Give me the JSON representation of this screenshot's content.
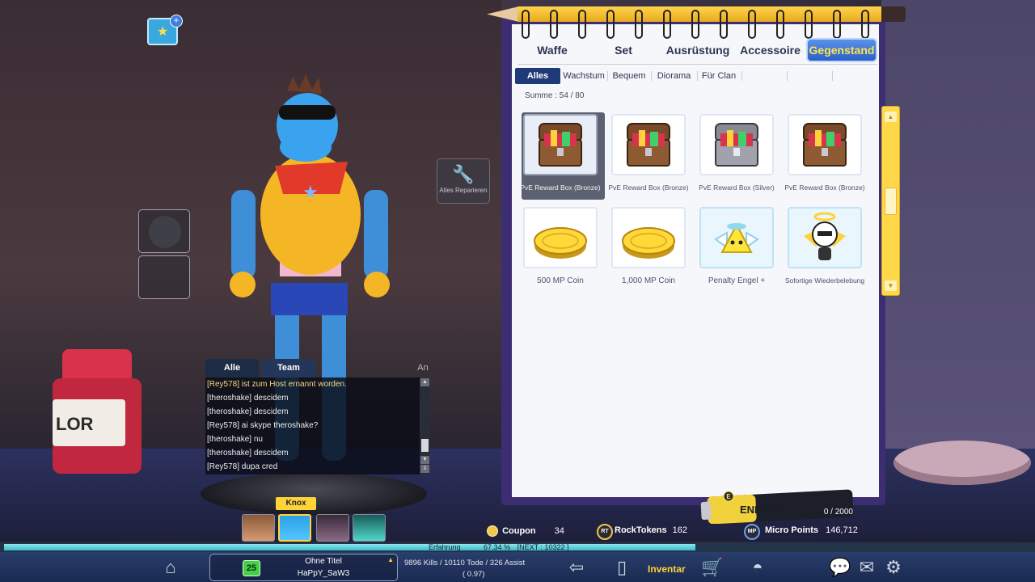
{
  "repair_label": "Alles Reparieren",
  "chat": {
    "tabs": [
      "Alle",
      "Team"
    ],
    "extra_tab": "An",
    "lines": [
      {
        "text": "[Rey578] ist zum Host ernannt worden.",
        "system": true
      },
      {
        "text": "[theroshake] descidem",
        "system": false
      },
      {
        "text": "[theroshake] descidem",
        "system": false
      },
      {
        "text": "[Rey578] ai skype theroshake?",
        "system": false
      },
      {
        "text": "[theroshake] nu",
        "system": false
      },
      {
        "text": "[theroshake] descidem",
        "system": false
      },
      {
        "text": "[Rey578] dupa cred",
        "system": false
      }
    ]
  },
  "character": {
    "nametag": "Knox",
    "portraits": [
      "character-portrait-1",
      "character-portrait-knox",
      "character-portrait-3",
      "character-portrait-4"
    ]
  },
  "inventory": {
    "main_tabs": [
      "Waffe",
      "Set",
      "Ausrüstung",
      "Accessoire",
      "Gegenstand"
    ],
    "active_main_tab": "Gegenstand",
    "sub_tabs": [
      "Alles",
      "Wachstum",
      "Bequem",
      "Diorama",
      "Für Clan"
    ],
    "active_sub_tab": "Alles",
    "summe_label": "Summe :",
    "summe_value": "54 / 80",
    "items": [
      {
        "name": "PvE Reward Box (Bronze)",
        "icon": "treasure-chest-icon",
        "selected": true
      },
      {
        "name": "PvE Reward Box (Bronze)",
        "icon": "treasure-chest-icon",
        "selected": false
      },
      {
        "name": "PvE Reward Box (Silver)",
        "icon": "treasure-chest-silver-icon",
        "selected": false
      },
      {
        "name": "PvE Reward Box (Bronze)",
        "icon": "treasure-chest-icon",
        "selected": false
      },
      {
        "name": "500 MP Coin",
        "icon": "mp-coin-icon",
        "selected": false
      },
      {
        "name": "1,000 MP Coin",
        "icon": "mp-coin-icon",
        "selected": false
      },
      {
        "name": "Penalty Engel +",
        "icon": "penalty-angel-icon",
        "selected": false
      },
      {
        "name": "Sofortige Wiederbelebung",
        "icon": "revive-angel-icon",
        "selected": false
      }
    ]
  },
  "energy": {
    "label": "ENERGY",
    "value": "0 / 2000",
    "badge": "E"
  },
  "currency": {
    "coupon_label": "Coupon",
    "coupon_value": "34",
    "rock_badge": "RT",
    "rock_label": "RockTokens",
    "rock_value": "162",
    "mp_badge": "MP",
    "mp_label": "Micro Points",
    "mp_value": "146,712"
  },
  "xp": {
    "label": "Erfahrung",
    "percent_text": "67.34 %",
    "next_text": "[NEXT : 10322 ]",
    "percent": 67.34
  },
  "profile": {
    "level": "25",
    "title": "Ohne Titel",
    "name": "HaPpY_SaW3"
  },
  "stats": {
    "line1": "9896 Kills / 10110 Tode / 326 Assist",
    "line2": "( 0.97)"
  },
  "bottom_nav": {
    "inventar_label": "Inventar",
    "icons": [
      "home-icon",
      "back-arrow-icon",
      "clipboard-icon",
      "shopping-cart-icon",
      "helmet-icon",
      "chat-bubble-icon",
      "mail-icon",
      "gear-icon"
    ]
  },
  "colors": {
    "accent_tab": "#2c5fc7",
    "active_tab_text": "#ffe54c",
    "level_badge": "#46d04a",
    "notebook": "#3d2e73"
  }
}
